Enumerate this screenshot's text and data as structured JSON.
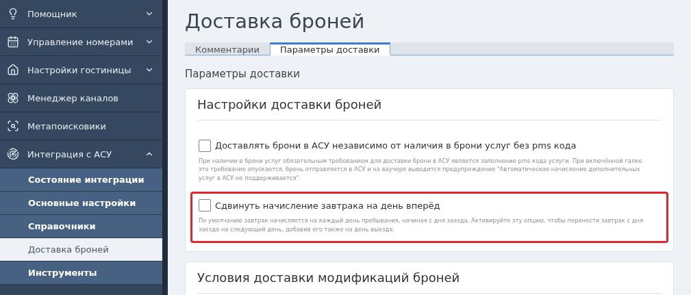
{
  "sidebar": {
    "items": [
      {
        "label": "Помощник",
        "expanded": false
      },
      {
        "label": "Управление номерами",
        "expanded": false
      },
      {
        "label": "Настройки гостиницы",
        "expanded": false
      },
      {
        "label": "Менеджер каналов"
      },
      {
        "label": "Метапоисковики"
      },
      {
        "label": "Интеграция с АСУ",
        "expanded": true,
        "children": [
          {
            "label": "Состояние интеграции",
            "selected": false
          },
          {
            "label": "Основные настройки",
            "selected": false
          },
          {
            "label": "Справочники",
            "selected": false
          },
          {
            "label": "Доставка броней",
            "selected": true
          },
          {
            "label": "Инструменты",
            "selected": false
          }
        ]
      }
    ]
  },
  "page": {
    "title": "Доставка броней"
  },
  "tabs": [
    {
      "label": "Комментарии",
      "selected": false
    },
    {
      "label": "Параметры доставки",
      "selected": true
    }
  ],
  "section_title": "Параметры доставки",
  "cards": [
    {
      "title": "Настройки доставки броней",
      "options": [
        {
          "label": "Доставлять брони в АСУ независимо от наличия в брони услуг без pms кода",
          "checked": false,
          "highlighted": false,
          "hint": "При наличии в брони услуг обязательным требованием для доставки брони в АСУ является заполнение pms кода услуги. При включённой галке это требование опускается, бронь отправляется в АСУ и на ваучере выводится предупреждение \"Автоматическое начисление дополнительных услуг в АСУ не поддерживается\"."
        },
        {
          "label": "Сдвинуть начисление завтрака на день вперёд",
          "checked": false,
          "highlighted": true,
          "hint": "По умолчанию завтрак начисляется на каждый день пребывания, начиная с дня заезда. Активируйте эту опцию, чтобы перенести завтрак с дня заезда на следующий день, добавив его также на день выезда."
        }
      ]
    },
    {
      "title": "Условия доставки модификаций броней"
    }
  ]
}
